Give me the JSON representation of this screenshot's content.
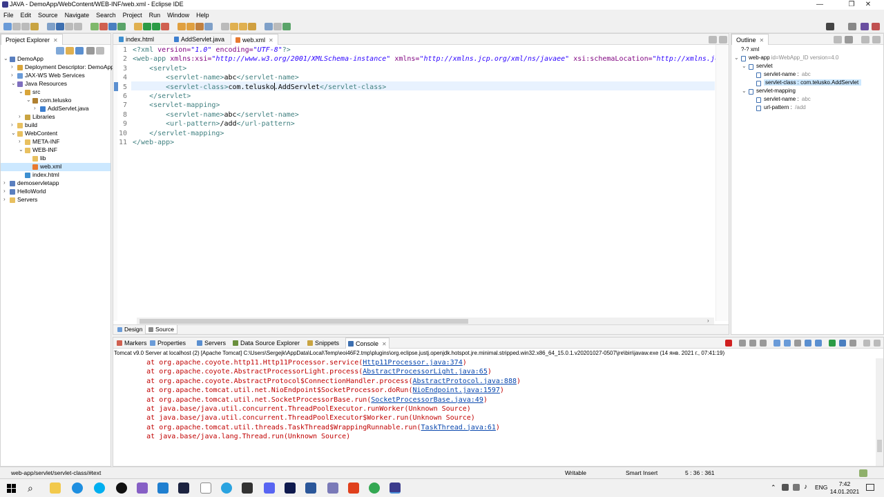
{
  "window": {
    "title": "JAVA - DemoApp/WebContent/WEB-INF/web.xml - Eclipse IDE",
    "minimize": "—",
    "maximize": "❐",
    "close": "✕"
  },
  "menu": [
    "File",
    "Edit",
    "Source",
    "Navigate",
    "Search",
    "Project",
    "Run",
    "Window",
    "Help"
  ],
  "project_explorer": {
    "tab_label": "Project Explorer",
    "items": [
      {
        "label": "DemoApp",
        "depth": 0,
        "twisty": "open",
        "icon": "project-icon"
      },
      {
        "label": "Deployment Descriptor: DemoApp",
        "depth": 1,
        "twisty": "closed",
        "icon": "descriptor-icon"
      },
      {
        "label": "JAX-WS Web Services",
        "depth": 1,
        "twisty": "closed",
        "icon": "webservice-icon"
      },
      {
        "label": "Java Resources",
        "depth": 1,
        "twisty": "open",
        "icon": "java-resources-icon"
      },
      {
        "label": "src",
        "depth": 2,
        "twisty": "open",
        "icon": "source-folder-icon"
      },
      {
        "label": "com.telusko",
        "depth": 3,
        "twisty": "open",
        "icon": "package-icon"
      },
      {
        "label": "AddServlet.java",
        "depth": 4,
        "twisty": "closed",
        "icon": "java-file-icon"
      },
      {
        "label": "Libraries",
        "depth": 2,
        "twisty": "closed",
        "icon": "library-icon"
      },
      {
        "label": "build",
        "depth": 1,
        "twisty": "closed",
        "icon": "folder-icon"
      },
      {
        "label": "WebContent",
        "depth": 1,
        "twisty": "open",
        "icon": "folder-icon"
      },
      {
        "label": "META-INF",
        "depth": 2,
        "twisty": "closed",
        "icon": "folder-icon"
      },
      {
        "label": "WEB-INF",
        "depth": 2,
        "twisty": "open",
        "icon": "folder-icon"
      },
      {
        "label": "lib",
        "depth": 3,
        "twisty": "none",
        "icon": "folder-icon"
      },
      {
        "label": "web.xml",
        "depth": 3,
        "twisty": "none",
        "icon": "xml-file-icon",
        "selected": true
      },
      {
        "label": "index.html",
        "depth": 2,
        "twisty": "none",
        "icon": "html-file-icon"
      },
      {
        "label": "demoservletapp",
        "depth": 0,
        "twisty": "closed",
        "icon": "project-icon"
      },
      {
        "label": "HelloWorld",
        "depth": 0,
        "twisty": "closed",
        "icon": "project-icon"
      },
      {
        "label": "Servers",
        "depth": 0,
        "twisty": "closed",
        "icon": "folder-icon"
      }
    ]
  },
  "editor": {
    "tabs": [
      {
        "label": "index.html",
        "active": false
      },
      {
        "label": "AddServlet.java",
        "active": false
      },
      {
        "label": "web.xml",
        "active": true
      }
    ],
    "close_glyph": "✕",
    "line_numbers": [
      "1",
      "2",
      "3",
      "4",
      "5",
      "6",
      "7",
      "8",
      "9",
      "10",
      "11"
    ],
    "lines": [
      [
        {
          "t": "<?xml ",
          "c": "tagc"
        },
        {
          "t": "version=",
          "c": "attr"
        },
        {
          "t": "\"1.0\"",
          "c": "str"
        },
        {
          "t": " encoding=",
          "c": "attr"
        },
        {
          "t": "\"UTF-8\"",
          "c": "str"
        },
        {
          "t": "?>",
          "c": "tagc"
        }
      ],
      [
        {
          "t": "<web-app ",
          "c": "tagc"
        },
        {
          "t": "xmlns:xsi=",
          "c": "attr"
        },
        {
          "t": "\"http://www.w3.org/2001/XMLSchema-instance\"",
          "c": "str"
        },
        {
          "t": " xmlns=",
          "c": "attr"
        },
        {
          "t": "\"http://xmlns.jcp.org/xml/ns/javaee\"",
          "c": "str"
        },
        {
          "t": " xsi:schemaLocation=",
          "c": "attr"
        },
        {
          "t": "\"http://xmlns.jc",
          "c": "str"
        }
      ],
      [
        {
          "t": "    <servlet>",
          "c": "tagc"
        }
      ],
      [
        {
          "t": "        <servlet-name>",
          "c": "tagc"
        },
        {
          "t": "abc",
          "c": ""
        },
        {
          "t": "</servlet-name>",
          "c": "tagc"
        }
      ],
      [
        {
          "t": "        <servlet-class>",
          "c": "tagc"
        },
        {
          "t": "com.telusko.AddServlet",
          "c": ""
        },
        {
          "t": "</servlet-class>",
          "c": "tagc"
        }
      ],
      [
        {
          "t": "    </servlet>",
          "c": "tagc"
        }
      ],
      [
        {
          "t": "    <servlet-mapping>",
          "c": "tagc"
        }
      ],
      [
        {
          "t": "        <servlet-name>",
          "c": "tagc"
        },
        {
          "t": "abc",
          "c": ""
        },
        {
          "t": "</servlet-name>",
          "c": "tagc"
        }
      ],
      [
        {
          "t": "        <url-pattern>",
          "c": "tagc"
        },
        {
          "t": "/add",
          "c": ""
        },
        {
          "t": "</url-pattern>",
          "c": "tagc"
        }
      ],
      [
        {
          "t": "    </servlet-mapping>",
          "c": "tagc"
        }
      ],
      [
        {
          "t": "</web-app>",
          "c": "tagc"
        }
      ]
    ],
    "bottom_tabs": [
      "Design",
      "Source"
    ]
  },
  "outline": {
    "tab_label": "Outline",
    "items": [
      {
        "label": "?-? xml",
        "extra": "",
        "depth": 0,
        "twisty": "none"
      },
      {
        "label": "web-app",
        "extra": "id=WebApp_ID version=4.0",
        "depth": 0,
        "twisty": "open"
      },
      {
        "label": "servlet",
        "extra": "",
        "depth": 1,
        "twisty": "open"
      },
      {
        "label": "servlet-name : ",
        "extra": "abc",
        "depth": 2,
        "twisty": "none"
      },
      {
        "label": "servlet-class : com.telusko.AddServlet",
        "extra": "",
        "depth": 2,
        "twisty": "none",
        "selected": true
      },
      {
        "label": "servlet-mapping",
        "extra": "",
        "depth": 1,
        "twisty": "open"
      },
      {
        "label": "servlet-name : ",
        "extra": "abc",
        "depth": 2,
        "twisty": "none"
      },
      {
        "label": "url-pattern : ",
        "extra": "/add",
        "depth": 2,
        "twisty": "none"
      }
    ]
  },
  "console": {
    "tabs": [
      "Markers",
      "Properties",
      "Servers",
      "Data Source Explorer",
      "Snippets",
      "Console"
    ],
    "header": "Tomcat v9.0 Server at localhost (2) [Apache Tomcat] C:\\Users\\Sergejk\\AppData\\Local\\Temp\\eoi46F2.tmp\\plugins\\org.eclipse.justj.openjdk.hotspot.jre.minimal.stripped.win32.x86_64_15.0.1.v20201027-0507\\jre\\bin\\javaw.exe  (14 янв. 2021 г., 07:41:19)",
    "lines": [
      {
        "pre": "        at org.apache.coyote.http11.Http11Processor.service(",
        "link": "Http11Processor.java:374",
        "post": ")"
      },
      {
        "pre": "        at org.apache.coyote.AbstractProcessorLight.process(",
        "link": "AbstractProcessorLight.java:65",
        "post": ")"
      },
      {
        "pre": "        at org.apache.coyote.AbstractProtocol$ConnectionHandler.process(",
        "link": "AbstractProtocol.java:888",
        "post": ")"
      },
      {
        "pre": "        at org.apache.tomcat.util.net.NioEndpoint$SocketProcessor.doRun(",
        "link": "NioEndpoint.java:1597",
        "post": ")"
      },
      {
        "pre": "        at org.apache.tomcat.util.net.SocketProcessorBase.run(",
        "link": "SocketProcessorBase.java:49",
        "post": ")"
      },
      {
        "pre": "        at java.base/java.util.concurrent.ThreadPoolExecutor.runWorker(Unknown Source)",
        "link": "",
        "post": ""
      },
      {
        "pre": "        at java.base/java.util.concurrent.ThreadPoolExecutor$Worker.run(Unknown Source)",
        "link": "",
        "post": ""
      },
      {
        "pre": "        at org.apache.tomcat.util.threads.TaskThread$WrappingRunnable.run(",
        "link": "TaskThread.java:61",
        "post": ")"
      },
      {
        "pre": "        at java.base/java.lang.Thread.run(Unknown Source)",
        "link": "",
        "post": ""
      }
    ]
  },
  "status": {
    "path": "web-app/servlet/servlet-class/#text",
    "writable": "Writable",
    "insert_mode": "Smart Insert",
    "position": "5 : 36 : 361"
  },
  "taskbar": {
    "lang": "ENG",
    "time": "7:42",
    "date": "14.01.2021"
  },
  "colors": {
    "accent": "#cde8ff",
    "selection": "#cce8ff",
    "console_error": "#c00000",
    "link": "#0645ad"
  }
}
